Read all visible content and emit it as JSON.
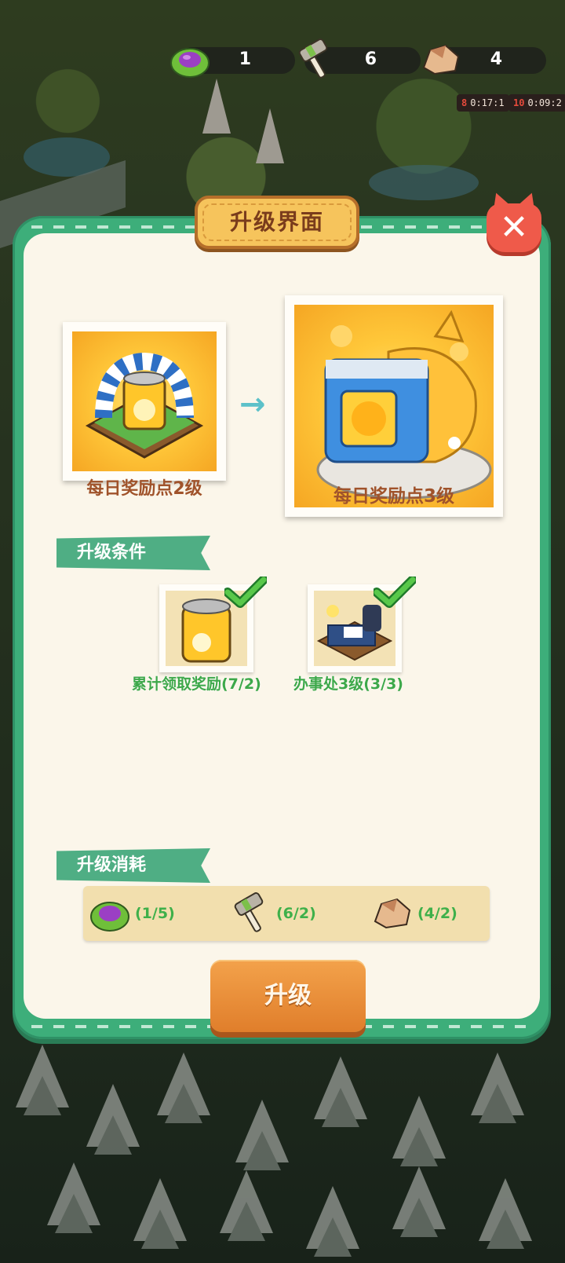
{
  "resources": [
    {
      "icon": "cabbage-icon",
      "value": "1"
    },
    {
      "icon": "hammer-icon",
      "value": "6"
    },
    {
      "icon": "stone-icon",
      "value": "4"
    }
  ],
  "timers": [
    {
      "level": "8",
      "time": "0:17:1"
    },
    {
      "level": "10",
      "time": "0:09:2"
    }
  ],
  "dialog": {
    "title": "升级界面",
    "close_icon": "close-icon",
    "current": {
      "caption": "每日奖励点2级"
    },
    "next": {
      "caption": "每日奖励点3级"
    },
    "conditions_label": "升级条件",
    "conditions": [
      {
        "label": "累计领取奖励(7/2)",
        "met": true
      },
      {
        "label": "办事处3级(3/3)",
        "met": true
      }
    ],
    "cost_label": "升级消耗",
    "costs": [
      {
        "icon": "cabbage-icon",
        "text": "(1/5)"
      },
      {
        "icon": "hammer-icon",
        "text": "(6/2)"
      },
      {
        "icon": "stone-icon",
        "text": "(4/2)"
      }
    ],
    "upgrade_button": "升级"
  },
  "colors": {
    "panel_green": "#3dae7a",
    "title_plate": "#f6c45c",
    "close_red": "#ef5a4a",
    "caption_brown": "#a0532b",
    "condition_green": "#3da84a",
    "button_orange": "#e88c35"
  }
}
